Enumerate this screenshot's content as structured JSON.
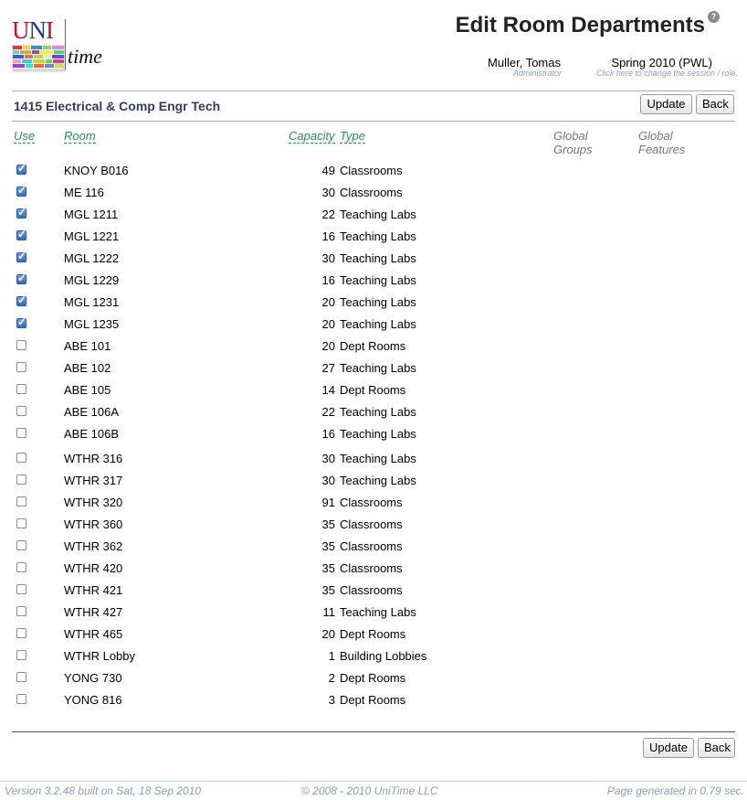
{
  "header": {
    "logo": {
      "uni": "UNI",
      "time": "time"
    },
    "title": "Edit Room Departments",
    "help_icon": "help-icon",
    "user": {
      "name": "Muller, Tomas",
      "role": "Administrator"
    },
    "session": {
      "name": "Spring 2010 (PWL)",
      "hint": "Click here to change the session / role."
    }
  },
  "department": {
    "title": "1415 Electrical & Comp Engr Tech"
  },
  "buttons": {
    "update": "Update",
    "back": "Back"
  },
  "columns": {
    "use": "Use",
    "room": "Room",
    "capacity": "Capacity",
    "type": "Type",
    "global_groups": [
      "Global",
      "Groups"
    ],
    "global_features": [
      "Global",
      "Features"
    ]
  },
  "rows": [
    {
      "checked": true,
      "room": "KNOY B016",
      "capacity": "49",
      "type": "Classrooms"
    },
    {
      "checked": true,
      "room": "ME 116",
      "capacity": "30",
      "type": "Classrooms"
    },
    {
      "checked": true,
      "room": "MGL 1211",
      "capacity": "22",
      "type": "Teaching Labs"
    },
    {
      "checked": true,
      "room": "MGL 1221",
      "capacity": "16",
      "type": "Teaching Labs"
    },
    {
      "checked": true,
      "room": "MGL 1222",
      "capacity": "30",
      "type": "Teaching Labs"
    },
    {
      "checked": true,
      "room": "MGL 1229",
      "capacity": "16",
      "type": "Teaching Labs"
    },
    {
      "checked": true,
      "room": "MGL 1231",
      "capacity": "20",
      "type": "Teaching Labs"
    },
    {
      "checked": true,
      "room": "MGL 1235",
      "capacity": "20",
      "type": "Teaching Labs"
    },
    {
      "checked": false,
      "room": "ABE 101",
      "capacity": "20",
      "type": "Dept Rooms"
    },
    {
      "checked": false,
      "room": "ABE 102",
      "capacity": "27",
      "type": "Teaching Labs"
    },
    {
      "checked": false,
      "room": "ABE 105",
      "capacity": "14",
      "type": "Dept Rooms"
    },
    {
      "checked": false,
      "room": "ABE 106A",
      "capacity": "22",
      "type": "Teaching Labs"
    },
    {
      "checked": false,
      "room": "ABE 106B",
      "capacity": "16",
      "type": "Teaching Labs"
    },
    {
      "checked": false,
      "room": "WTHR 316",
      "capacity": "30",
      "type": "Teaching Labs"
    },
    {
      "checked": false,
      "room": "WTHR 317",
      "capacity": "30",
      "type": "Teaching Labs"
    },
    {
      "checked": false,
      "room": "WTHR 320",
      "capacity": "91",
      "type": "Classrooms"
    },
    {
      "checked": false,
      "room": "WTHR 360",
      "capacity": "35",
      "type": "Classrooms"
    },
    {
      "checked": false,
      "room": "WTHR 362",
      "capacity": "35",
      "type": "Classrooms"
    },
    {
      "checked": false,
      "room": "WTHR 420",
      "capacity": "35",
      "type": "Classrooms"
    },
    {
      "checked": false,
      "room": "WTHR 421",
      "capacity": "35",
      "type": "Classrooms"
    },
    {
      "checked": false,
      "room": "WTHR 427",
      "capacity": "11",
      "type": "Teaching Labs"
    },
    {
      "checked": false,
      "room": "WTHR 465",
      "capacity": "20",
      "type": "Dept Rooms"
    },
    {
      "checked": false,
      "room": "WTHR Lobby",
      "capacity": "1",
      "type": "Building Lobbies"
    },
    {
      "checked": false,
      "room": "YONG 730",
      "capacity": "2",
      "type": "Dept Rooms"
    },
    {
      "checked": false,
      "room": "YONG 816",
      "capacity": "3",
      "type": "Dept Rooms"
    }
  ],
  "footer": {
    "version": "Version 3.2.48 built on Sat, 18 Sep 2010",
    "copyright": "© 2008 - 2010 UniTime LLC",
    "generated": "Page generated in 0.79 sec."
  }
}
